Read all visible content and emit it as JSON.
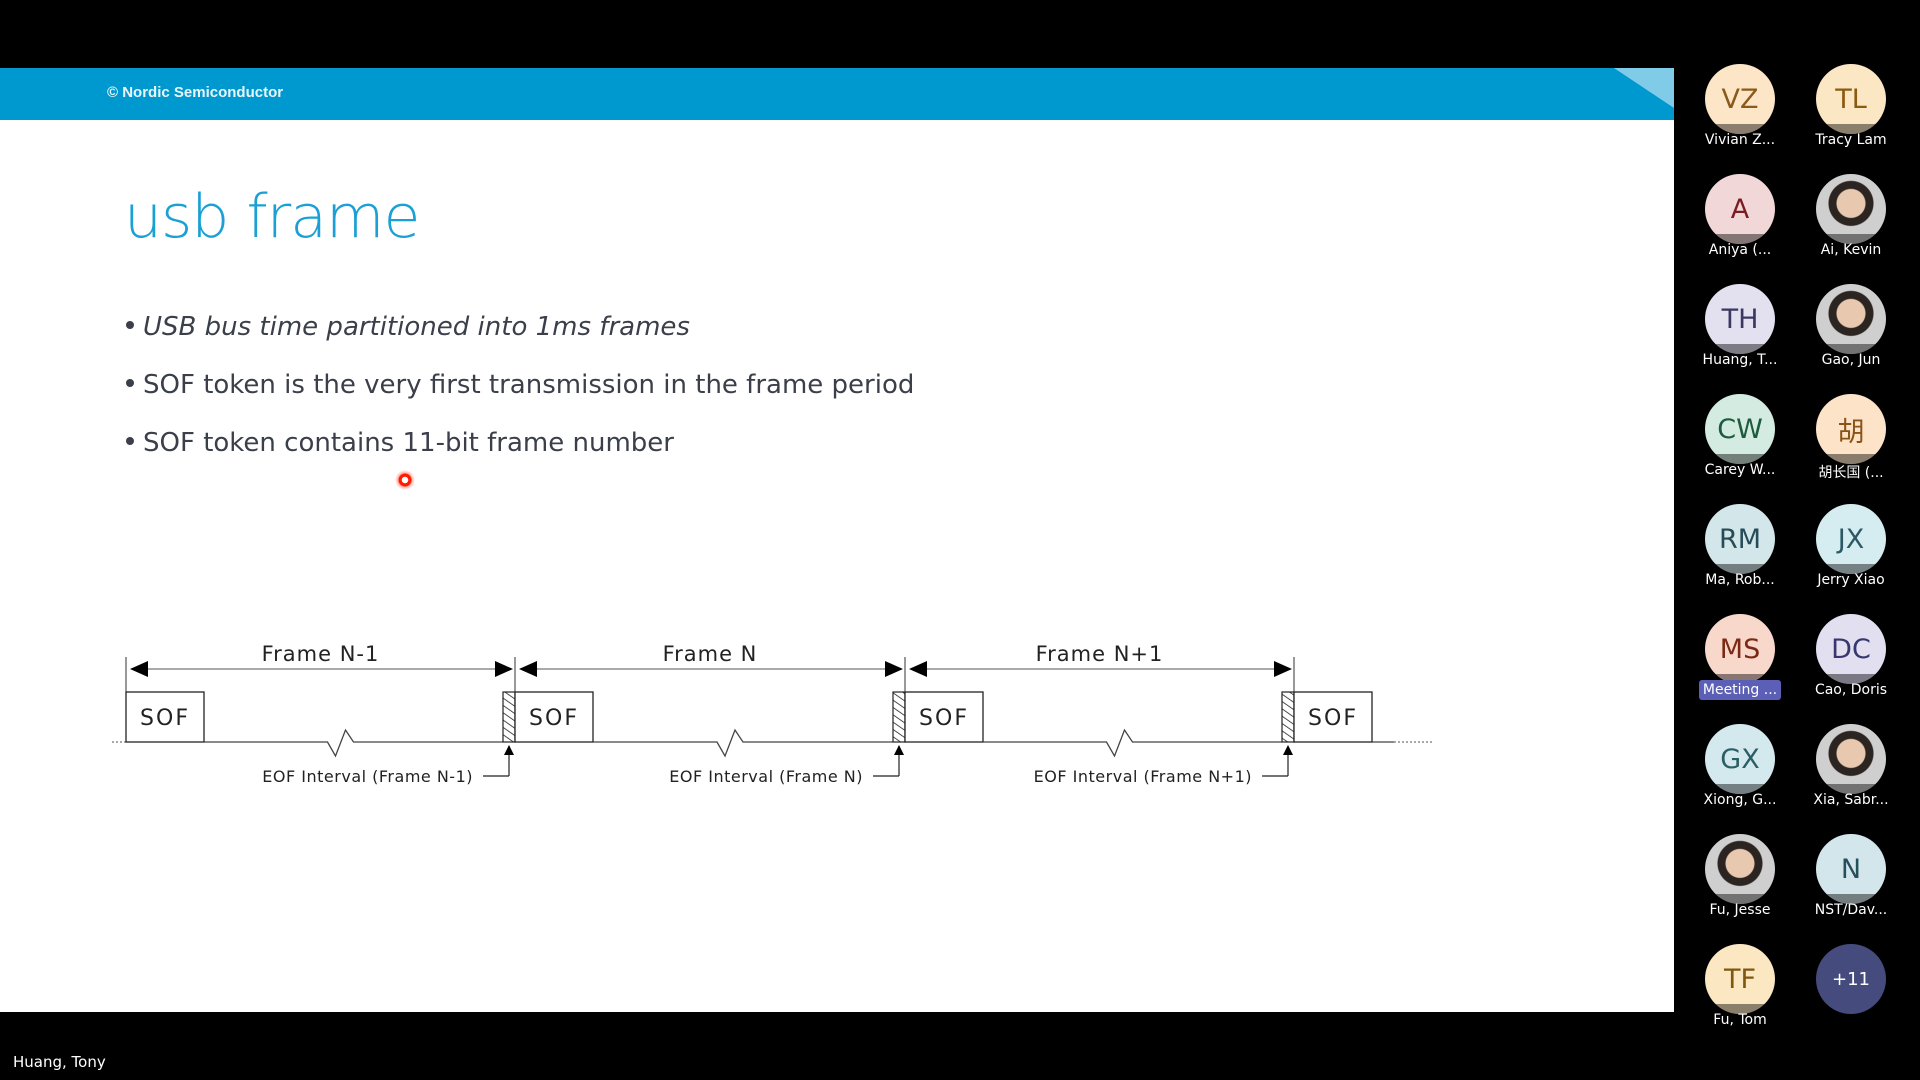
{
  "slide": {
    "copyright": "© Nordic Semiconductor",
    "title": "usb frame",
    "bullets": [
      {
        "text": "USB bus time partitioned into 1ms frames",
        "italic": true
      },
      {
        "text": "SOF token is the very first transmission in the frame period",
        "italic": false
      },
      {
        "text": "SOF token contains 11-bit frame number",
        "italic": false
      }
    ],
    "colors": {
      "header": "#0099cf",
      "title": "#1aa0d4",
      "laser": "#ff1a00"
    },
    "diagram": {
      "frames": [
        {
          "label": "Frame N-1",
          "eof_label": "EOF Interval (Frame N-1)"
        },
        {
          "label": "Frame N",
          "eof_label": "EOF Interval (Frame N)"
        },
        {
          "label": "Frame N+1",
          "eof_label": "EOF Interval (Frame N+1)"
        }
      ],
      "sof_label": "SOF"
    }
  },
  "participants": [
    {
      "initials": "VZ",
      "name": "Vivian Z...",
      "bg": "#fde5c8",
      "fg": "#8a5a1a"
    },
    {
      "initials": "TL",
      "name": "Tracy Lam",
      "bg": "#fbe7c3",
      "fg": "#8a5a10"
    },
    {
      "initials": "A",
      "name": "Aniya (...",
      "bg": "#f2d7d8",
      "fg": "#7a1c22"
    },
    {
      "initials": "",
      "name": "Ai, Kevin",
      "photo": true
    },
    {
      "initials": "TH",
      "name": "Huang, T...",
      "bg": "#e3e1ef",
      "fg": "#3a3860"
    },
    {
      "initials": "",
      "name": "Gao, Jun",
      "photo": true
    },
    {
      "initials": "CW",
      "name": "Carey W...",
      "bg": "#d3ebe0",
      "fg": "#1e5a3e"
    },
    {
      "initials": "胡",
      "name": "胡长国 (...",
      "bg": "#fde3c8",
      "fg": "#8a5418"
    },
    {
      "initials": "RM",
      "name": "Ma, Rob...",
      "bg": "#d3e6ea",
      "fg": "#264c57"
    },
    {
      "initials": "JX",
      "name": "Jerry Xiao",
      "bg": "#d5ecf1",
      "fg": "#2b5a66"
    },
    {
      "initials": "MS",
      "name": "Meeting ...",
      "bg": "#f9d8cc",
      "fg": "#7a2a14",
      "highlight": true
    },
    {
      "initials": "DC",
      "name": "Cao, Doris",
      "bg": "#e1dff0",
      "fg": "#383670"
    },
    {
      "initials": "GX",
      "name": "Xiong, G...",
      "bg": "#d3e9ee",
      "fg": "#2b5e66"
    },
    {
      "initials": "",
      "name": "Xia, Sabr...",
      "photo": true
    },
    {
      "initials": "",
      "name": "Fu, Jesse",
      "photo": true
    },
    {
      "initials": "N",
      "name": "NST/Dav...",
      "bg": "#d3e6ec",
      "fg": "#24505c"
    },
    {
      "initials": "TF",
      "name": "Fu, Tom",
      "bg": "#fbe8c2",
      "fg": "#7f5710"
    }
  ],
  "more_participants": "+11",
  "presenter": "Huang, Tony"
}
